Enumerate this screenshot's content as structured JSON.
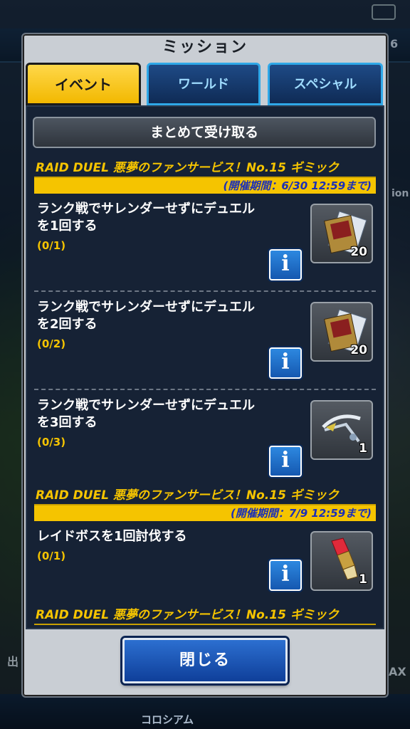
{
  "background": {
    "bottom_label": "コロシアム",
    "left_edge_text": "出",
    "right_edge_text": "AX",
    "mid_right_text": "ion",
    "corner_number": "6"
  },
  "dialog": {
    "title": "ミッション",
    "claim_all_label": "まとめて受け取る",
    "close_label": "閉じる"
  },
  "tabs": [
    {
      "label": "イベント",
      "active": true
    },
    {
      "label": "ワールド",
      "active": false
    },
    {
      "label": "スペシャル",
      "active": false
    }
  ],
  "groups": [
    {
      "title": "RAID DUEL 悪夢のファンサービス！No.15 ギミック",
      "period": "(開催期間：6/30 12:59まで)",
      "missions": [
        {
          "text": "ランク戦でサレンダーせずにデュエルを1回する",
          "line1": "ランク戦でサレンダーせずにデュエル",
          "line2": "を1回する",
          "progress": "(0/1)",
          "reward": "card-pack-icon",
          "count": "20"
        },
        {
          "text": "ランク戦でサレンダーせずにデュエルを2回する",
          "line1": "ランク戦でサレンダーせずにデュエル",
          "line2": "を2回する",
          "progress": "(0/2)",
          "reward": "card-pack-icon",
          "count": "20"
        },
        {
          "text": "ランク戦でサレンダーせずにデュエルを3回する",
          "line1": "ランク戦でサレンダーせずにデュエル",
          "line2": "を3回する",
          "progress": "(0/3)",
          "reward": "crossbow-icon",
          "count": "1"
        }
      ]
    },
    {
      "title": "RAID DUEL 悪夢のファンサービス！No.15 ギミック",
      "period": "(開催期間：7/9 12:59まで)",
      "missions": [
        {
          "line1": "レイドボスを1回討伐する",
          "progress": "(0/1)",
          "reward": "red-crystal-icon",
          "count": "1"
        }
      ]
    },
    {
      "title": "RAID DUEL 悪夢のファンサービス！No.15 ギミック"
    }
  ],
  "colors": {
    "accent_yellow": "#f5c400",
    "period_text_blue": "#1b2fb8",
    "panel_bg": "#162235",
    "info_blue": "#1f6fd0"
  }
}
